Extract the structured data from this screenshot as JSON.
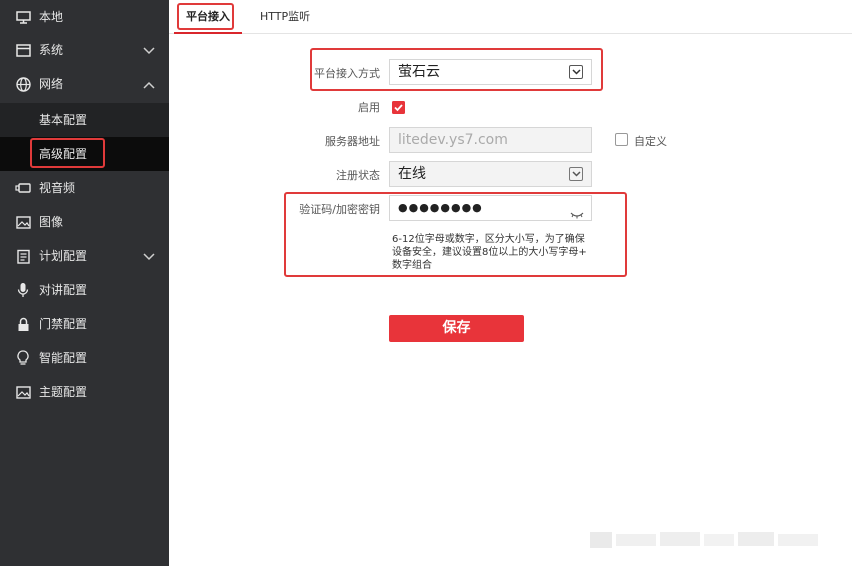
{
  "sidebar": {
    "items": [
      {
        "label": "本地",
        "icon": "monitor-icon"
      },
      {
        "label": "系统",
        "icon": "system-icon",
        "chevron": "chevron-down-icon"
      },
      {
        "label": "网络",
        "icon": "globe-icon",
        "chevron": "chevron-up-icon"
      },
      {
        "label": "基本配置"
      },
      {
        "label": "高级配置"
      },
      {
        "label": "视音频",
        "icon": "camera-icon"
      },
      {
        "label": "图像",
        "icon": "image-icon"
      },
      {
        "label": "计划配置",
        "icon": "schedule-icon",
        "chevron": "chevron-down-icon"
      },
      {
        "label": "对讲配置",
        "icon": "microphone-icon"
      },
      {
        "label": "门禁配置",
        "icon": "lock-icon"
      },
      {
        "label": "智能配置",
        "icon": "bulb-icon"
      },
      {
        "label": "主题配置",
        "icon": "theme-icon"
      }
    ]
  },
  "tabs": [
    {
      "label": "平台接入"
    },
    {
      "label": "HTTP监听"
    }
  ],
  "form": {
    "access_mode_label": "平台接入方式",
    "access_mode_value": "萤石云",
    "enable_label": "启用",
    "enable_checked": true,
    "server_label": "服务器地址",
    "server_value": "litedev.ys7.com",
    "custom_label": "自定义",
    "status_label": "注册状态",
    "status_value": "在线",
    "key_label": "验证码/加密密钥",
    "key_value": "●●●●●●●●",
    "hint_line1": "6-12位字母或数字，区分大小写，为了确保",
    "hint_line2": "设备安全，建议设置8位以上的大小写字母+",
    "hint_line3": "数字组合",
    "save_label": "保存"
  },
  "colors": {
    "sidebar_bg": "#2f3033",
    "active_bg": "#0c0c0c",
    "accent_red": "#e8343a",
    "highlight_red": "#e03a3a"
  }
}
